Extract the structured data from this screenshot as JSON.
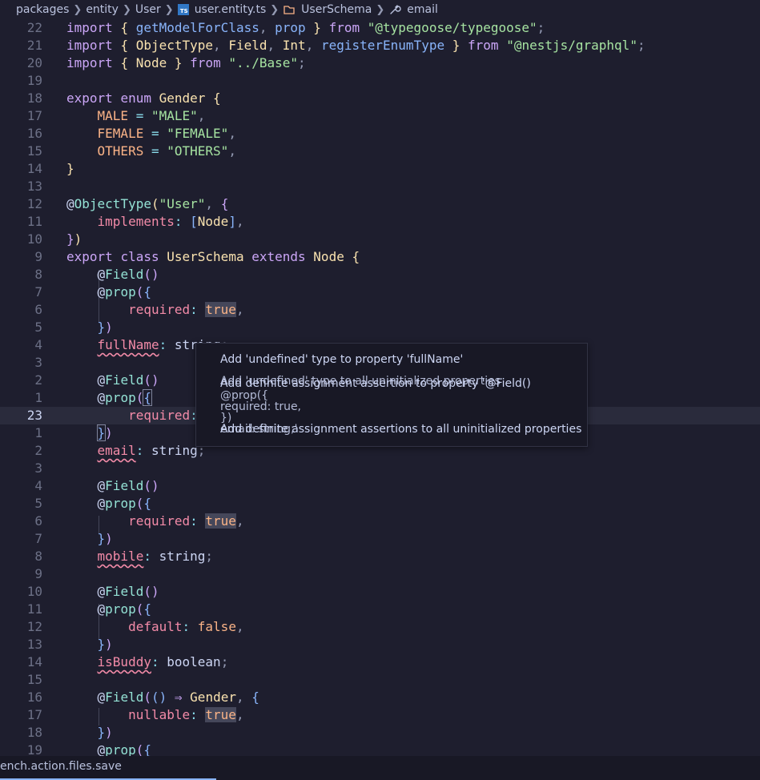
{
  "breadcrumb": {
    "items": [
      "packages",
      "entity",
      "User",
      "user.entity.ts",
      "UserSchema",
      "email"
    ],
    "ts_badge": "TS"
  },
  "editor": {
    "line_numbers": [
      "22",
      "21",
      "20",
      "19",
      "18",
      "17",
      "16",
      "15",
      "14",
      "13",
      "12",
      "11",
      "10",
      "9",
      "8",
      "7",
      "6",
      "5",
      "4",
      "3",
      "2",
      "1",
      "23",
      "1",
      "2",
      "3",
      "4",
      "5",
      "6",
      "7",
      "8",
      "9",
      "10",
      "11",
      "12",
      "13",
      "14",
      "15",
      "16",
      "17",
      "18",
      "19"
    ],
    "current_line_number": "23",
    "tokens": {
      "import": "import",
      "from": "from",
      "export": "export",
      "enum": "enum",
      "class": "class",
      "extends": "extends",
      "getModelForClass": "getModelForClass",
      "prop": "prop",
      "typegoose_path": "\"@typegoose/typegoose\"",
      "ObjectType": "ObjectType",
      "Field": "Field",
      "Int": "Int",
      "registerEnumType": "registerEnumType",
      "graphql_path": "\"@nestjs/graphql\"",
      "Node": "Node",
      "base_path": "\"../Base\"",
      "Gender": "Gender",
      "MALE": "MALE",
      "FEMALE": "FEMALE",
      "OTHERS": "OTHERS",
      "MALE_str": "\"MALE\"",
      "FEMALE_str": "\"FEMALE\"",
      "OTHERS_str": "\"OTHERS\"",
      "User_str": "\"User\"",
      "implements": "implements",
      "UserSchema": "UserSchema",
      "required": "required",
      "true": "true",
      "false": "false",
      "fullName": "fullName",
      "email": "email",
      "mobile": "mobile",
      "default": "default",
      "isBuddy": "isBuddy",
      "nullable": "nullable",
      "string": "string",
      "boolean": "boolean",
      "arrow": "⇒"
    }
  },
  "hover_menu": {
    "items": [
      "Add 'undefined' type to property 'fullName'",
      "Add definite assignment assertion to property '@Field()",
      "Add definite assignment assertions to all uninitialized properties"
    ],
    "overlay_items": [
      "Add 'undefined' type to all uninitialized properties",
      "@prop({",
      "required: true,",
      "})",
      "email: string;'"
    ]
  },
  "statusbar": {
    "message": "ench.action.files.save"
  },
  "colors": {
    "background": "#1e1e2e",
    "keyword": "#cba6f7",
    "function": "#89b4fa",
    "string": "#a6e3a1",
    "property": "#f38ba8",
    "type": "#f9e2af",
    "error_squiggle": "#f38ba8"
  }
}
